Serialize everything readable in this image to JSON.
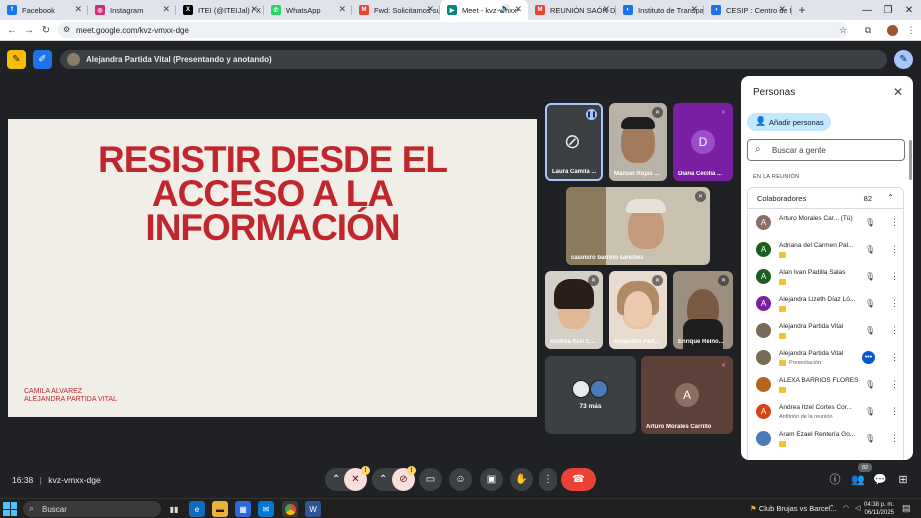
{
  "browser": {
    "tabs": [
      {
        "label": "Facebook",
        "color": "#1877f2",
        "glyph": "f",
        "active": false
      },
      {
        "label": "Instagram",
        "color": "#d62976",
        "glyph": "◎",
        "active": false
      },
      {
        "label": "ITEI (@ITEIJal) / X",
        "color": "#000000",
        "glyph": "X",
        "active": false
      },
      {
        "label": "WhatsApp",
        "color": "#25d366",
        "glyph": "✆",
        "active": false
      },
      {
        "label": "Fwd: Solicitamos su a",
        "color": "#ea4335",
        "glyph": "M",
        "active": false
      },
      {
        "label": "Meet - kvz-vmxx-",
        "color": "#00897b",
        "glyph": "▶",
        "active": true
      },
      {
        "label": "REUNIÓN SAÓN DE",
        "color": "#ea4335",
        "glyph": "M",
        "active": false
      },
      {
        "label": "Instituto de Transpa",
        "color": "#1a73e8",
        "glyph": "◐",
        "active": false
      },
      {
        "label": "CESIP : Centro de Est",
        "color": "#1a73e8",
        "glyph": "◑",
        "active": false
      }
    ],
    "url": "meet.google.com/kvz-vmxx-dge"
  },
  "meet": {
    "presenting_banner": "Alejandra Partida Vital (Presentando y anotando)",
    "slide": {
      "title_lines": [
        "RESISTIR  DESDE EL",
        "ACCESO A LA",
        "INFORMACIÓN"
      ],
      "footer_lines": [
        "CAMILA ALVAREZ",
        "ALEJANDRA PARTIDA VITAL"
      ]
    },
    "tiles": {
      "t1": "Laura Camila ...",
      "t2": "Manuel Rojas ...",
      "t3": "Diana Cecilia ...",
      "t3_initial": "D",
      "t4": "casimiro barreto sanchez",
      "t5": "Andrea Itzel C...",
      "t6": "Alejandra Part...",
      "t7": "Enrique Reino...",
      "more": "73 más",
      "t9": "Arturo Morales Carrillo",
      "t9_initial": "A"
    },
    "meeting_time": "16:38",
    "meeting_code": "kvz-vmxx-dge",
    "people_count_badge": "82",
    "hint_badge": "!"
  },
  "panel": {
    "title": "Personas",
    "add_people": "Añadir personas",
    "search_placeholder": "Buscar a gente",
    "section": "EN LA REUNIÓN",
    "group": "Colaboradores",
    "group_count": "82",
    "people": [
      {
        "name": "Arturo Morales Car... (Tú)",
        "sub": "",
        "initial": "A",
        "color": "#8d6e63",
        "badge": false,
        "presenting": false
      },
      {
        "name": "Adriana del Carmen Pal...",
        "sub": "",
        "initial": "A",
        "color": "#1b5e20",
        "badge": true,
        "presenting": false
      },
      {
        "name": "Alan Ivan Padilla Salas",
        "sub": "",
        "initial": "A",
        "color": "#1b5e20",
        "badge": true,
        "presenting": false
      },
      {
        "name": "Alejandra Lizeth Díaz Ló...",
        "sub": "",
        "initial": "A",
        "color": "#7b1fa2",
        "badge": true,
        "presenting": false
      },
      {
        "name": "Alejandra Partida Vital",
        "sub": "",
        "initial": "",
        "color": "#7a6a5a",
        "badge": true,
        "presenting": false
      },
      {
        "name": "Alejandra Partida Vital",
        "sub": "Presentación",
        "initial": "",
        "color": "#7a6a5a",
        "badge": true,
        "presenting": true
      },
      {
        "name": "ALEXA BARRIOS FLORES",
        "sub": "",
        "initial": "",
        "color": "#b5651d",
        "badge": true,
        "presenting": false
      },
      {
        "name": "Andrea Itzel Cortes Cor...",
        "sub": "Anfitrión de la reunión",
        "initial": "A",
        "color": "#d84315",
        "badge": false,
        "presenting": false
      },
      {
        "name": "Aram Ezael Rentería Go...",
        "sub": "",
        "initial": "",
        "color": "#4a7ab8",
        "badge": true,
        "presenting": false
      }
    ]
  },
  "taskbar": {
    "search": "Buscar",
    "news": "Club Brujas vs Barcel...",
    "time": "04:38 p. m.",
    "date": "06/11/2025"
  }
}
